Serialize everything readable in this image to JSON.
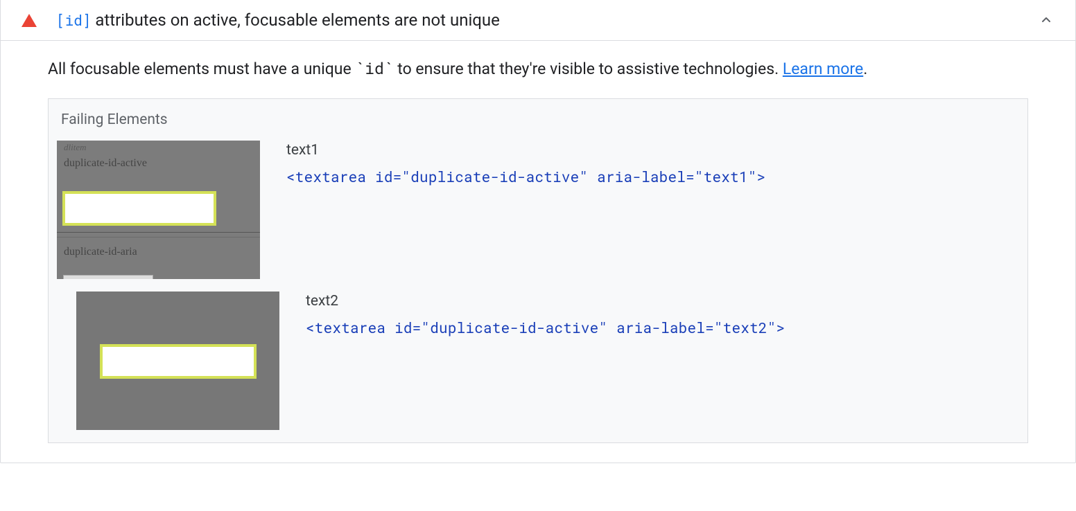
{
  "header": {
    "code_badge": "[id]",
    "title_rest": " attributes on active, focusable elements are not unique"
  },
  "description": {
    "pre": "All focusable elements must have a unique ",
    "code": "`id`",
    "post": " to ensure that they're visible to assistive technologies. ",
    "link_text": "Learn more",
    "tail": "."
  },
  "failing": {
    "title": "Failing Elements",
    "items": [
      {
        "label": "text1",
        "snippet": "<textarea id=\"duplicate-id-active\" aria-label=\"text1\">",
        "thumb_labels": {
          "top": "dlitem",
          "a": "duplicate-id-active",
          "b": "duplicate-id-aria"
        }
      },
      {
        "label": "text2",
        "snippet": "<textarea id=\"duplicate-id-active\" aria-label=\"text2\">"
      }
    ]
  }
}
